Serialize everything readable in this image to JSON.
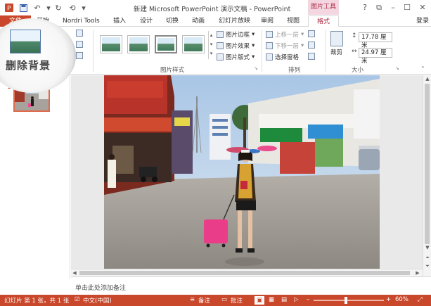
{
  "window": {
    "title": "新建 Microsoft PowerPoint 演示文稿 - PowerPoint",
    "contextual_tab_group": "图片工具",
    "controls": {
      "help": "?",
      "restore": "⧉",
      "minimize": "–",
      "maximize": "☐",
      "close": "✕"
    }
  },
  "quick_access": {
    "save_icon": "save-icon",
    "undo_icon": "undo-icon",
    "redo_icon": "redo-icon"
  },
  "tabs": [
    {
      "label": "文件"
    },
    {
      "label": "开始"
    },
    {
      "label": "Nordri Tools"
    },
    {
      "label": "插入"
    },
    {
      "label": "设计"
    },
    {
      "label": "切换"
    },
    {
      "label": "动画"
    },
    {
      "label": "幻灯片放映"
    },
    {
      "label": "审阅"
    },
    {
      "label": "视图"
    },
    {
      "label": "格式"
    }
  ],
  "account": {
    "login_label": "登录"
  },
  "ribbon": {
    "remove_bg_label": "删除背景",
    "picture_styles": {
      "group_label": "图片样式",
      "border_label": "图片边框",
      "effects_label": "图片效果",
      "layout_label": "图片版式"
    },
    "arrange": {
      "group_label": "排列",
      "bring_forward_label": "上移一层",
      "send_backward_label": "下移一层",
      "selection_pane_label": "选择窗格"
    },
    "size": {
      "group_label": "大小",
      "crop_label": "裁剪",
      "height_value": "17.78 厘米",
      "width_value": "24.97 厘米"
    }
  },
  "thumbnails": [
    {
      "number": "1"
    }
  ],
  "notes": {
    "placeholder": "单击此处添加备注"
  },
  "status": {
    "slide_info": "幻灯片 第 1 张，共 1 张",
    "language": "中文(中国)",
    "notes_label": "备注",
    "comments_label": "批注",
    "zoom": "60%"
  },
  "colors": {
    "accent": "#c9472a",
    "contextual": "#b0304a",
    "contextual_bg": "#f3d6e0"
  }
}
